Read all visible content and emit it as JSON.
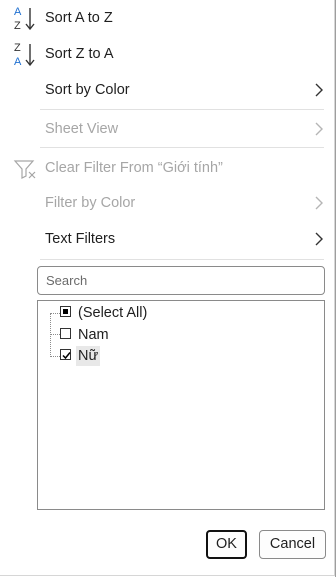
{
  "menu": {
    "sort_az": {
      "label": "Sort A to Z",
      "icon": "sort-ascending-icon"
    },
    "sort_za": {
      "label": "Sort Z to A",
      "icon": "sort-descending-icon"
    },
    "sort_by_color": {
      "label": "Sort by Color"
    },
    "sheet_view": {
      "label": "Sheet View",
      "disabled": true
    },
    "clear_filter": {
      "label": "Clear Filter From “Giới tính”",
      "disabled": true,
      "icon": "clear-filter-icon"
    },
    "filter_by_color": {
      "label": "Filter by Color",
      "disabled": true
    },
    "text_filters": {
      "label": "Text Filters"
    }
  },
  "search": {
    "placeholder": "Search"
  },
  "filter_list": [
    {
      "label": "(Select All)",
      "state": "indeterminate"
    },
    {
      "label": "Nam",
      "state": "unchecked"
    },
    {
      "label": "Nữ",
      "state": "checked"
    }
  ],
  "buttons": {
    "ok": "OK",
    "cancel": "Cancel"
  },
  "colors": {
    "disabled_text": "#a6a6a6",
    "text": "#1f1f1f",
    "border": "#8a8a8a",
    "accent_blue": "#1e6fd1"
  }
}
